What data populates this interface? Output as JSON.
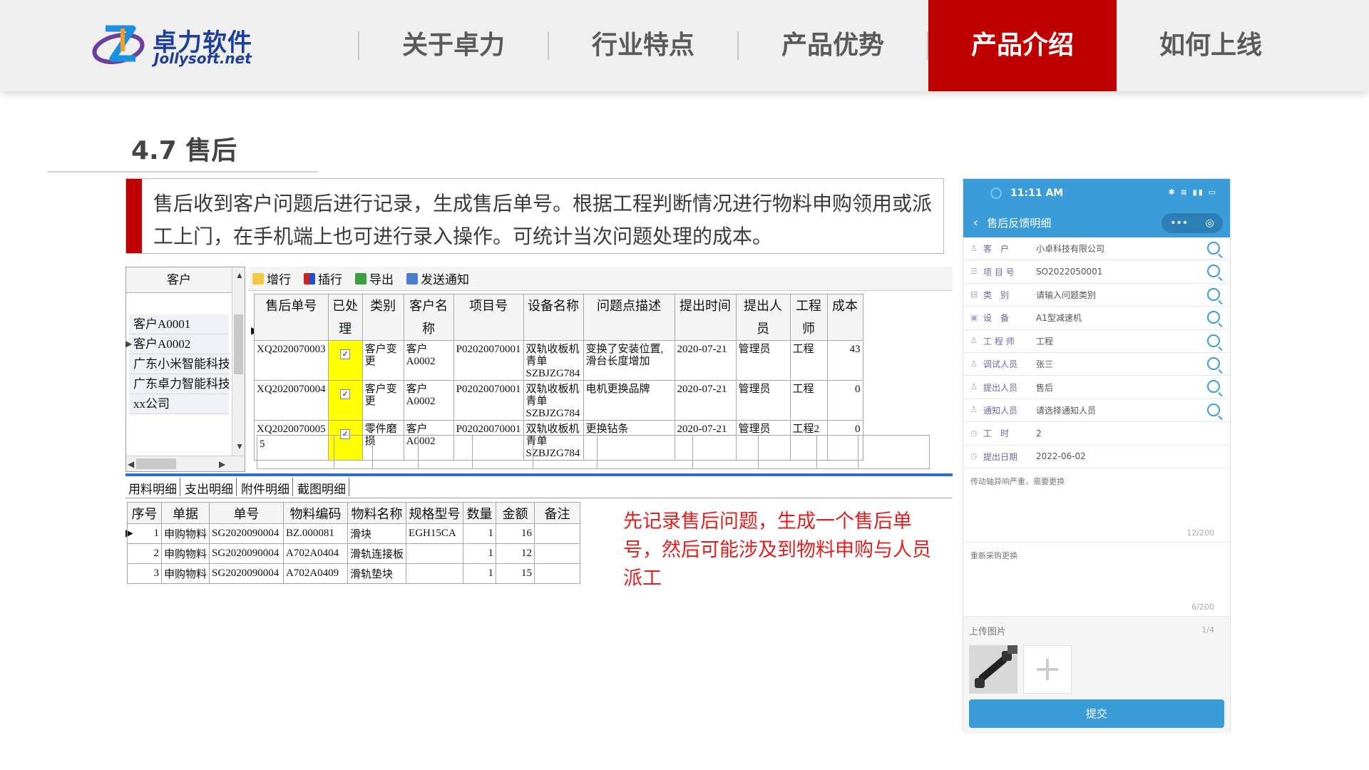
{
  "header": {
    "logo_cn": "卓力软件",
    "logo_en": "Jollysoft.net",
    "nav": [
      "关于卓力",
      "行业特点",
      "产品优势",
      "产品介绍",
      "如何上线"
    ],
    "active_index": 3
  },
  "section": {
    "title": "4.7 售后",
    "description": "售后收到客户问题后进行记录，生成售后单号。根据工程判断情况进行物料申购领用或派工上门，在手机端上也可进行录入操作。可统计当次问题处理的成本。"
  },
  "desktop": {
    "customer_header": "客户",
    "customers": [
      "客户A0001",
      "客户A0002",
      "广东小米智能科技",
      "广东卓力智能科技",
      "xx公司"
    ],
    "toolbar": [
      "增行",
      "插行",
      "导出",
      "发送通知"
    ],
    "columns": [
      "售后单号",
      "已处理",
      "类别",
      "客户名称",
      "项目号",
      "设备名称",
      "问题点描述",
      "提出时间",
      "提出人员",
      "工程师",
      "成本"
    ],
    "rows": [
      {
        "id": "XQ2020070003",
        "checked": "✓",
        "type": "客户变更",
        "customer": "客户A0002",
        "project": "P02020070001",
        "device": "双轨收板机青单SZBJZG784",
        "desc": "变换了安装位置,滑台长度增加",
        "time": "2020-07-21",
        "person": "管理员",
        "engineer": "工程",
        "cost": "43"
      },
      {
        "id": "XQ2020070004",
        "checked": "✓",
        "type": "客户变更",
        "customer": "客户A0002",
        "project": "P02020070001",
        "device": "双轨收板机青单SZBJZG784",
        "desc": "电机更换品牌",
        "time": "2020-07-21",
        "person": "管理员",
        "engineer": "工程",
        "cost": "0"
      },
      {
        "id": "XQ2020070005",
        "checked": "✓",
        "type": "零件磨损",
        "customer": "客户A0002",
        "project": "P02020070001",
        "device": "双轨收板机青单SZBJZG784",
        "desc": "更换钻条",
        "time": "2020-07-21",
        "person": "管理员",
        "engineer": "工程2",
        "cost": "0"
      }
    ],
    "summary_count": "5",
    "tabs": [
      "用料明细",
      "支出明细",
      "附件明细",
      "截图明细"
    ],
    "detail_columns": [
      "序号",
      "单据",
      "单号",
      "物料编码",
      "物料名称",
      "规格型号",
      "数量",
      "金额",
      "备注"
    ],
    "detail_rows": [
      {
        "no": "1",
        "doc": "申购物料",
        "num": "SG2020090004",
        "code": "BZ.000081",
        "name": "滑块",
        "spec": "EGH15CA",
        "qty": "1",
        "amount": "16",
        "remark": ""
      },
      {
        "no": "2",
        "doc": "申购物料",
        "num": "SG2020090004",
        "code": "A702A0404",
        "name": "滑轨连接板",
        "spec": "",
        "qty": "1",
        "amount": "12",
        "remark": ""
      },
      {
        "no": "3",
        "doc": "申购物料",
        "num": "SG2020090004",
        "code": "A702A0409",
        "name": "滑轨垫块",
        "spec": "",
        "qty": "1",
        "amount": "15",
        "remark": ""
      }
    ],
    "note": "先记录售后问题，生成一个售后单号，然后可能涉及到物料申购与人员派工"
  },
  "phone": {
    "time": "11:11 AM",
    "title": "售后反馈明细",
    "fields": [
      {
        "label": "客　户",
        "value": "小卓科技有限公司",
        "search": true
      },
      {
        "label": "项 目 号",
        "value": "SO2022050001",
        "search": true
      },
      {
        "label": "类　别",
        "value": "请输入问题类别",
        "search": true
      },
      {
        "label": "设　备",
        "value": "A1型减速机",
        "search": true
      },
      {
        "label": "工 程 师",
        "value": "工程",
        "search": true
      },
      {
        "label": "调试人员",
        "value": "张三",
        "search": true
      },
      {
        "label": "提出人员",
        "value": "售后",
        "search": true
      },
      {
        "label": "通知人员",
        "value": "请选择通知人员",
        "search": true
      },
      {
        "label": "工　时",
        "value": "2",
        "search": false
      },
      {
        "label": "提出日期",
        "value": "2022-06-02",
        "search": false
      }
    ],
    "problem_text": "传动轴异响严重，需要更换",
    "problem_count": "12/200",
    "solution_text": "重新采购更换",
    "solution_count": "6/200",
    "upload_label": "上传图片",
    "upload_count": "1/4",
    "submit": "提交"
  },
  "colors": {
    "accent": "#c00000",
    "brand": "#1d3f9b",
    "phone": "#3a9cd8",
    "note": "#e02020"
  }
}
